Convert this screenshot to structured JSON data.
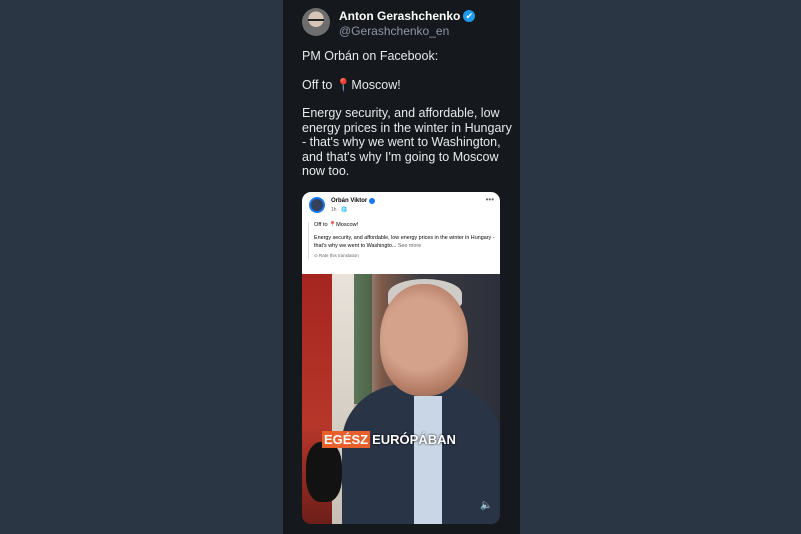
{
  "tweet": {
    "author_name": "Anton Gerashchenko",
    "author_handle": "@Gerashchenko_en",
    "verified_icon": "✔",
    "text_line1": "PM Orbán on Facebook:",
    "text_line2_prefix": "Off to ",
    "text_line2_icon": "📍",
    "text_line2_suffix": "Moscow!",
    "text_line3": "Energy security, and affordable, low energy prices in the winter in Hungary - that's why we went to Washington, and that's why I'm going to Moscow now too."
  },
  "facebook_post": {
    "author_name": "Orbán Viktor",
    "meta": "1h · 🌐",
    "dots": "•••",
    "line1_prefix": "Off to ",
    "line1_icon": "📍",
    "line1_suffix": "Moscow!",
    "line2": "Energy security, and affordable, low energy prices in the winter in Hungary - that's why we went to Washingto...",
    "see_more": "See more",
    "rate_translation": "⊙ Rate this translation"
  },
  "video": {
    "caption_part1": "EGÉSZ",
    "caption_part2": "EURÓPÁBAN",
    "mute_icon": "🔈"
  }
}
